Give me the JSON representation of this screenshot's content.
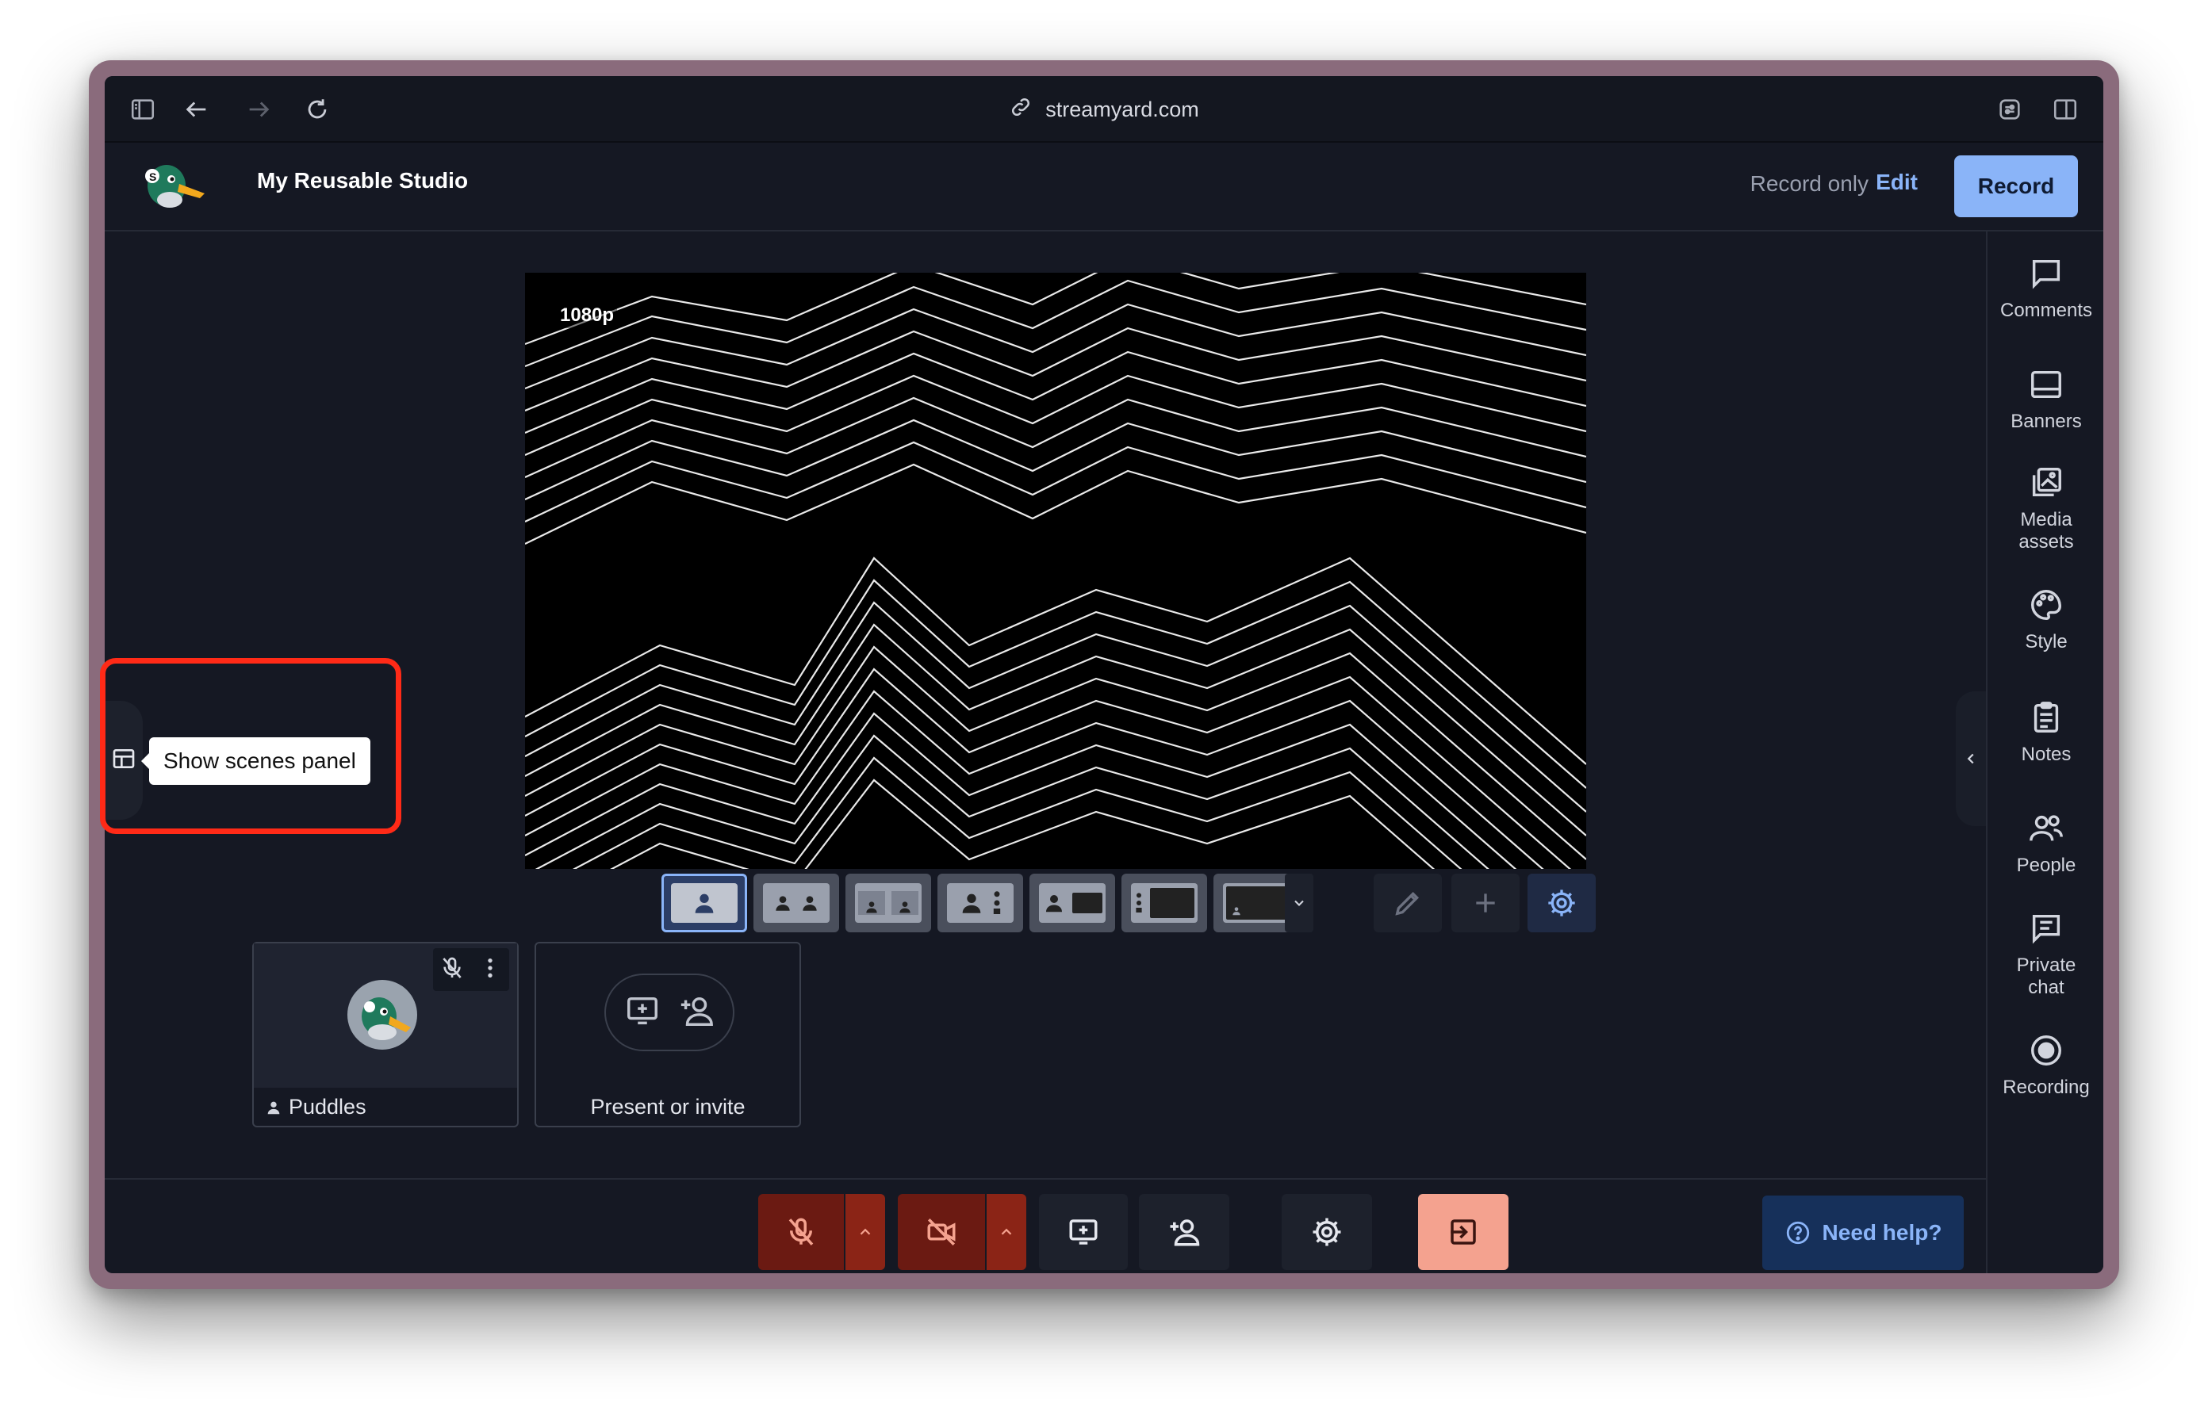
{
  "browser": {
    "url": "streamyard.com",
    "icons": [
      "sidebar-icon",
      "back-arrow-icon",
      "forward-arrow-icon",
      "reload-icon",
      "link-icon",
      "extension-icon",
      "split-view-icon"
    ]
  },
  "header": {
    "studio_title": "My Reusable Studio",
    "record_only": "Record only",
    "edit_label": "Edit",
    "record_label": "Record"
  },
  "stage": {
    "resolution": "1080p"
  },
  "sidebar": {
    "items": [
      {
        "label": "Comments",
        "icon": "comment-icon"
      },
      {
        "label": "Banners",
        "icon": "banner-icon"
      },
      {
        "label": "Media\nassets",
        "icon": "media-assets-icon"
      },
      {
        "label": "Style",
        "icon": "palette-icon"
      },
      {
        "label": "Notes",
        "icon": "notes-icon"
      },
      {
        "label": "People",
        "icon": "people-icon"
      },
      {
        "label": "Private\nchat",
        "icon": "private-chat-icon"
      },
      {
        "label": "Recording",
        "icon": "recording-icon"
      }
    ]
  },
  "participants": [
    {
      "name": "Puddles"
    },
    {
      "name": "Present or invite"
    }
  ],
  "tooltip": {
    "text": "Show scenes panel"
  },
  "help": {
    "label": "Need help?"
  },
  "colors": {
    "background": "#151823",
    "accent": "#8ab4f8",
    "mic_off": "#6b1a12",
    "leave": "#f4a28f",
    "highlight": "#ff2a17"
  }
}
